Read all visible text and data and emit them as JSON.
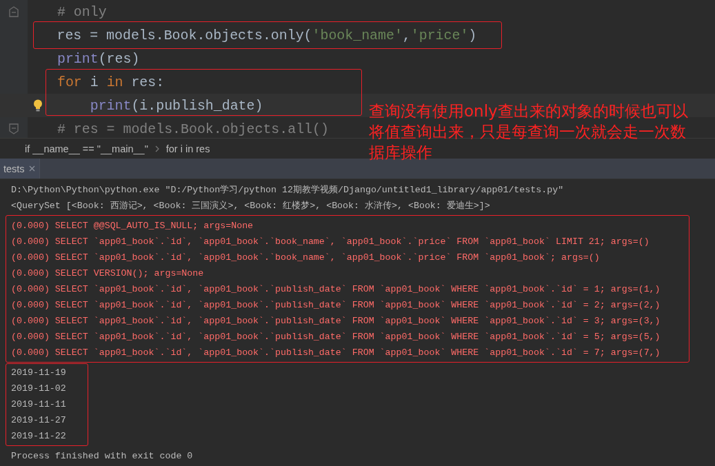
{
  "editor": {
    "lines": [
      {
        "kind": "fold-start",
        "current": false,
        "tokens": [
          {
            "kind": "comment",
            "text": "# only"
          }
        ]
      },
      {
        "current": false,
        "circled": true,
        "tokens": [
          {
            "kind": "plain",
            "text": "res = models.Book.objects.only("
          },
          {
            "kind": "string",
            "text": "'book_name'"
          },
          {
            "kind": "plain",
            "text": ","
          },
          {
            "kind": "string",
            "text": "'price'"
          },
          {
            "kind": "plain",
            "text": ")"
          }
        ]
      },
      {
        "current": false,
        "tokens": [
          {
            "kind": "builtin",
            "text": "print"
          },
          {
            "kind": "plain",
            "text": "(res)"
          }
        ]
      },
      {
        "current": false,
        "tokens": [
          {
            "kind": "keyword",
            "text": "for"
          },
          {
            "kind": "plain",
            "text": " i "
          },
          {
            "kind": "keyword",
            "text": "in"
          },
          {
            "kind": "plain",
            "text": " res:"
          }
        ]
      },
      {
        "current": true,
        "tokens": [
          {
            "kind": "builtin",
            "text": "    print"
          },
          {
            "kind": "plain",
            "text": "(i.publish_date)"
          }
        ]
      },
      {
        "kind": "fold-end",
        "current": false,
        "tokens": [
          {
            "kind": "comment",
            "text": "# res = models.Book.objects.all()"
          }
        ]
      }
    ]
  },
  "breadcrumb": [
    "if __name__ == \"__main__\"",
    "for i in res"
  ],
  "tool_tabs": [
    {
      "label": "tests",
      "selected": true
    }
  ],
  "console": {
    "lines": [
      {
        "kind": "plain",
        "text": "D:\\Python\\Python\\python.exe \"D:/Python学习/python 12期教学视频/Django/untitled1_library/app01/tests.py\""
      },
      {
        "kind": "plain",
        "text": "<QuerySet [<Book: 西游记>, <Book: 三国演义>, <Book: 红楼梦>, <Book: 水浒传>, <Book: 爱迪生>]>"
      },
      {
        "kind": "sql",
        "text": "(0.000) SELECT @@SQL_AUTO_IS_NULL; args=None"
      },
      {
        "kind": "sql",
        "text": "(0.000) SELECT `app01_book`.`id`, `app01_book`.`book_name`, `app01_book`.`price` FROM `app01_book` LIMIT 21; args=()"
      },
      {
        "kind": "sql",
        "text": "(0.000) SELECT `app01_book`.`id`, `app01_book`.`book_name`, `app01_book`.`price` FROM `app01_book`; args=()"
      },
      {
        "kind": "sql",
        "text": "(0.000) SELECT VERSION(); args=None"
      },
      {
        "kind": "sql",
        "text": "(0.000) SELECT `app01_book`.`id`, `app01_book`.`publish_date` FROM `app01_book` WHERE `app01_book`.`id` = 1; args=(1,)"
      },
      {
        "kind": "sql",
        "text": "(0.000) SELECT `app01_book`.`id`, `app01_book`.`publish_date` FROM `app01_book` WHERE `app01_book`.`id` = 2; args=(2,)"
      },
      {
        "kind": "sql",
        "text": "(0.000) SELECT `app01_book`.`id`, `app01_book`.`publish_date` FROM `app01_book` WHERE `app01_book`.`id` = 3; args=(3,)"
      },
      {
        "kind": "sql",
        "text": "(0.000) SELECT `app01_book`.`id`, `app01_book`.`publish_date` FROM `app01_book` WHERE `app01_book`.`id` = 5; args=(5,)"
      },
      {
        "kind": "sql",
        "text": "(0.000) SELECT `app01_book`.`id`, `app01_book`.`publish_date` FROM `app01_book` WHERE `app01_book`.`id` = 7; args=(7,)"
      },
      {
        "kind": "plain",
        "text": "2019-11-19"
      },
      {
        "kind": "plain",
        "text": "2019-11-02"
      },
      {
        "kind": "plain",
        "text": "2019-11-11"
      },
      {
        "kind": "plain",
        "text": "2019-11-27"
      },
      {
        "kind": "plain",
        "text": "2019-11-22"
      },
      {
        "kind": "status",
        "text": "Process finished with exit code 0"
      }
    ]
  },
  "annotation": {
    "text": "查询没有使用only查出来的对象的时候也可以将值查询出来，只是每查询一次就会走一次数据库操作"
  }
}
